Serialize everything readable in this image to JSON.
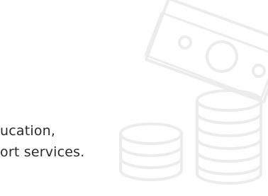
{
  "text": {
    "line1": "ucation,",
    "line2": "ort services."
  },
  "icons": {
    "bill": "banknote-icon",
    "coins": "coin-stack-icon"
  },
  "colors": {
    "text": "#2a2a2a",
    "illustration_stroke": "#eeeeee",
    "background": "#ffffff"
  }
}
